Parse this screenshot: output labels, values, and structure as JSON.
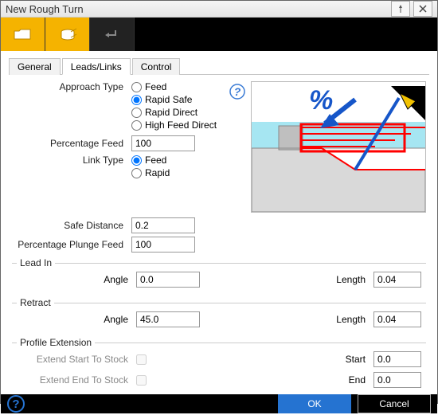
{
  "window": {
    "title": "New Rough Turn"
  },
  "tabs": {
    "general": "General",
    "leads": "Leads/Links",
    "control": "Control",
    "active_index": 1
  },
  "approach": {
    "label": "Approach Type",
    "options": {
      "feed": "Feed",
      "rapid_safe": "Rapid Safe",
      "rapid_direct": "Rapid Direct",
      "high_feed_direct": "High Feed Direct"
    },
    "selected": "rapid_safe"
  },
  "percentage_feed": {
    "label": "Percentage Feed",
    "value": "100"
  },
  "link_type": {
    "label": "Link Type",
    "options": {
      "feed": "Feed",
      "rapid": "Rapid"
    },
    "selected": "feed"
  },
  "safe_distance": {
    "label": "Safe Distance",
    "value": "0.2"
  },
  "percentage_plunge": {
    "label": "Percentage Plunge Feed",
    "value": "100"
  },
  "lead_in": {
    "legend": "Lead In",
    "angle_label": "Angle",
    "angle": "0.0",
    "length_label": "Length",
    "length": "0.04"
  },
  "retract": {
    "legend": "Retract",
    "angle_label": "Angle",
    "angle": "45.0",
    "length_label": "Length",
    "length": "0.04"
  },
  "profile_ext": {
    "legend": "Profile Extension",
    "extend_start_label": "Extend Start To Stock",
    "extend_start": false,
    "extend_end_label": "Extend End To Stock",
    "extend_end": false,
    "start_label": "Start",
    "start": "0.0",
    "end_label": "End",
    "end": "0.0"
  },
  "footer": {
    "ok": "OK",
    "cancel": "Cancel"
  },
  "diagram": {
    "symbol": "%"
  },
  "colors": {
    "accent": "#f5b300",
    "primary": "#2573d1"
  }
}
